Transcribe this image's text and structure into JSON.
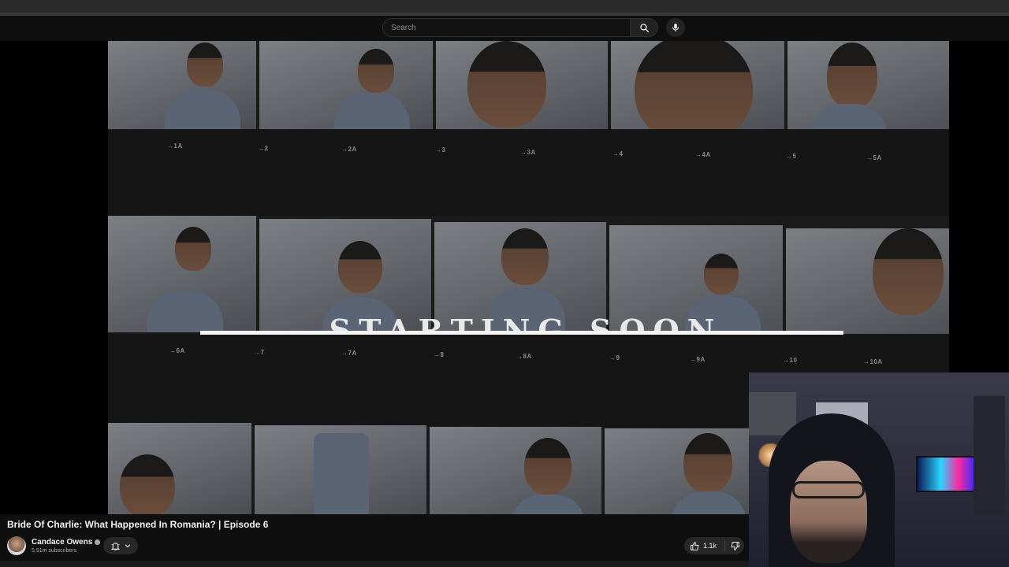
{
  "search": {
    "placeholder": "Search"
  },
  "icons": {
    "search": "search-icon",
    "mic": "microphone-icon",
    "bell": "bell-icon",
    "chevron": "chevron-down-icon",
    "like": "thumbs-up-icon",
    "dislike": "thumbs-down-icon",
    "verified": "verified-check-icon"
  },
  "video": {
    "overlay_text": "STARTING SOON",
    "frame_numbers_top": [
      "1A",
      "2",
      "2A",
      "3",
      "3A",
      "4",
      "4A",
      "5",
      "5A"
    ],
    "frame_numbers_mid": [
      "6A",
      "7",
      "7A",
      "8",
      "8A",
      "9",
      "9A",
      "10",
      "10A"
    ]
  },
  "video_info": {
    "title": "Bride Of Charlie: What Happened In Romania? | Episode 6",
    "channel_name": "Candace Owens",
    "subscribers": "5.91m subscribers",
    "likes": "1.1k"
  },
  "colors": {
    "background": "#0f0f0f",
    "button": "#272727",
    "text": "#f1f1f1"
  }
}
